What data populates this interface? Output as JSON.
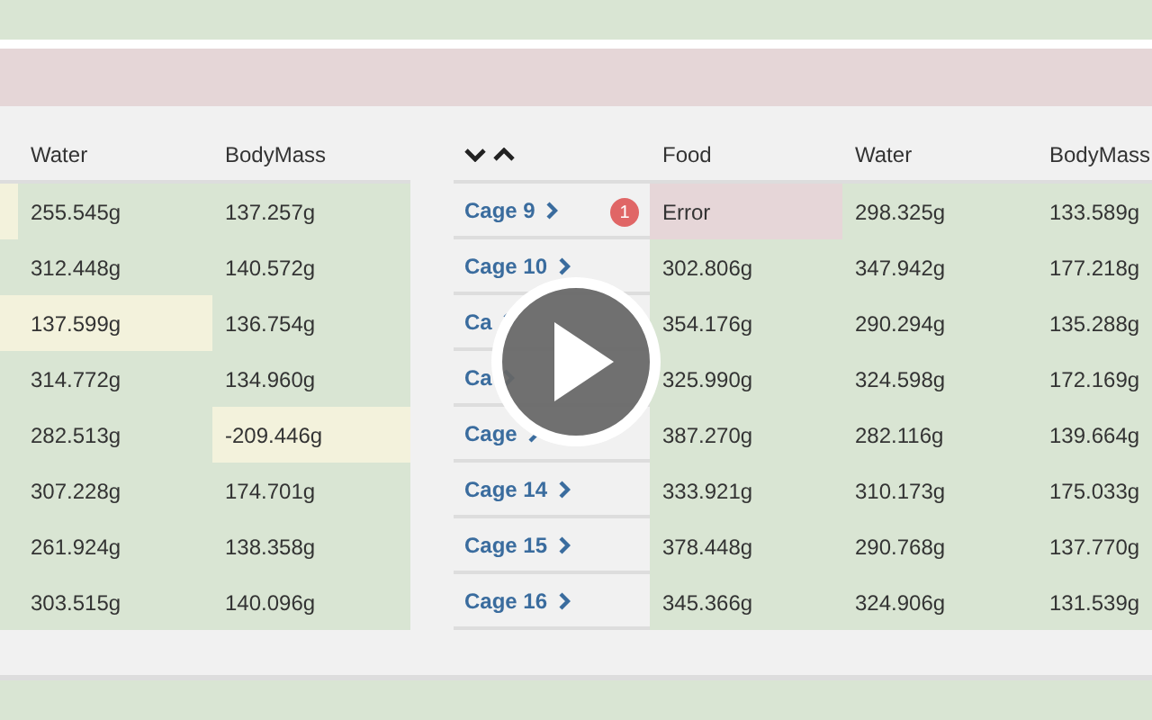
{
  "left_table": {
    "columns": [
      "Water",
      "BodyMass"
    ],
    "rows": [
      {
        "edge": {
          "color": "#f3f2dc"
        },
        "cells": [
          {
            "text": "255.545g",
            "color": "#d9e5d3"
          },
          {
            "text": "137.257g",
            "color": "#d9e5d3"
          }
        ]
      },
      {
        "cells": [
          {
            "text": "312.448g",
            "color": "#d9e5d3"
          },
          {
            "text": "140.572g",
            "color": "#d9e5d3"
          }
        ]
      },
      {
        "cells": [
          {
            "text": "137.599g",
            "color": "#f3f2dc"
          },
          {
            "text": "136.754g",
            "color": "#d9e5d3"
          }
        ]
      },
      {
        "cells": [
          {
            "text": "314.772g",
            "color": "#d9e5d3"
          },
          {
            "text": "134.960g",
            "color": "#d9e5d3"
          }
        ]
      },
      {
        "cells": [
          {
            "text": "282.513g",
            "color": "#d9e5d3"
          },
          {
            "text": "-209.446g",
            "color": "#f3f2dc"
          }
        ]
      },
      {
        "cells": [
          {
            "text": "307.228g",
            "color": "#d9e5d3"
          },
          {
            "text": "174.701g",
            "color": "#d9e5d3"
          }
        ]
      },
      {
        "cells": [
          {
            "text": "261.924g",
            "color": "#d9e5d3"
          },
          {
            "text": "138.358g",
            "color": "#d9e5d3"
          }
        ]
      },
      {
        "cells": [
          {
            "text": "303.515g",
            "color": "#d9e5d3"
          },
          {
            "text": "140.096g",
            "color": "#d9e5d3"
          }
        ]
      }
    ]
  },
  "right_table": {
    "columns": [
      "Food",
      "Water",
      "BodyMass"
    ],
    "rows": [
      {
        "name": "Cage 9",
        "badge": "1",
        "cells": [
          {
            "text": "Error",
            "color": "#e6d6d8"
          },
          {
            "text": "298.325g",
            "color": "#d9e5d3"
          },
          {
            "text": "133.589g",
            "color": "#d9e5d3"
          }
        ]
      },
      {
        "name": "Cage 10",
        "cells": [
          {
            "text": "302.806g",
            "color": "#d9e5d3"
          },
          {
            "text": "347.942g",
            "color": "#d9e5d3"
          },
          {
            "text": "177.218g",
            "color": "#d9e5d3"
          }
        ]
      },
      {
        "name": "Ca",
        "cells": [
          {
            "text": "354.176g",
            "color": "#d9e5d3"
          },
          {
            "text": "290.294g",
            "color": "#d9e5d3"
          },
          {
            "text": "135.288g",
            "color": "#d9e5d3"
          }
        ]
      },
      {
        "name": "Ca",
        "cells": [
          {
            "text": "325.990g",
            "color": "#d9e5d3"
          },
          {
            "text": "324.598g",
            "color": "#d9e5d3"
          },
          {
            "text": "172.169g",
            "color": "#d9e5d3"
          }
        ]
      },
      {
        "name": "Cage",
        "cells": [
          {
            "text": "387.270g",
            "color": "#d9e5d3"
          },
          {
            "text": "282.116g",
            "color": "#d9e5d3"
          },
          {
            "text": "139.664g",
            "color": "#d9e5d3"
          }
        ]
      },
      {
        "name": "Cage 14",
        "cells": [
          {
            "text": "333.921g",
            "color": "#d9e5d3"
          },
          {
            "text": "310.173g",
            "color": "#d9e5d3"
          },
          {
            "text": "175.033g",
            "color": "#d9e5d3"
          }
        ]
      },
      {
        "name": "Cage 15",
        "cells": [
          {
            "text": "378.448g",
            "color": "#d9e5d3"
          },
          {
            "text": "290.768g",
            "color": "#d9e5d3"
          },
          {
            "text": "137.770g",
            "color": "#d9e5d3"
          }
        ]
      },
      {
        "name": "Cage 16",
        "cells": [
          {
            "text": "345.366g",
            "color": "#d9e5d3"
          },
          {
            "text": "324.906g",
            "color": "#d9e5d3"
          },
          {
            "text": "131.539g",
            "color": "#d9e5d3"
          }
        ]
      }
    ]
  }
}
